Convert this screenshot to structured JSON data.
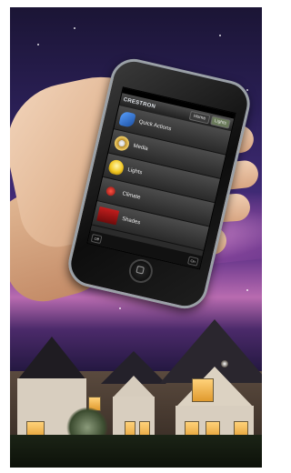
{
  "colors": {
    "sky_top": "#1b1535",
    "aurora": "#b86bb0",
    "window_glow": "#ffd27a",
    "phone_bezel": "#0d0d0d"
  },
  "phone": {
    "brand": "CRESTRON",
    "header_buttons": [
      "Home",
      "Lights"
    ],
    "rows": [
      {
        "label": "Quick Actions",
        "icon": "guitar-icon",
        "sub": ""
      },
      {
        "label": "Media",
        "icon": "dvd-icon",
        "sub": ""
      },
      {
        "label": "Lights",
        "icon": "light-bulb-icon",
        "sub": ""
      },
      {
        "label": "Climate",
        "icon": "thermometer-icon",
        "sub": ""
      },
      {
        "label": "Shades",
        "icon": "shades-icon",
        "sub": ""
      }
    ],
    "footer_left": "Off",
    "footer_right": "On"
  }
}
